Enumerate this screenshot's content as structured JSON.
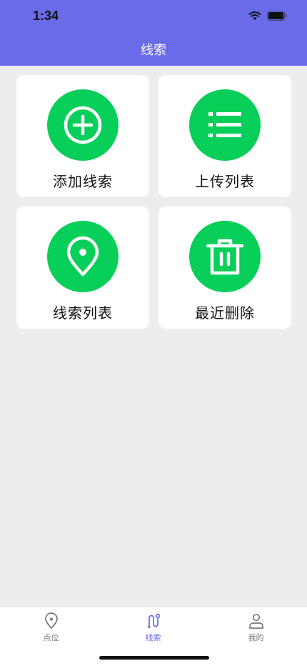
{
  "status_bar": {
    "time": "1:34"
  },
  "nav": {
    "title": "线索"
  },
  "cards": [
    {
      "label": "添加线索",
      "icon": "plus-circle-icon"
    },
    {
      "label": "上传列表",
      "icon": "list-icon"
    },
    {
      "label": "线索列表",
      "icon": "location-pin-icon"
    },
    {
      "label": "最近删除",
      "icon": "trash-icon"
    }
  ],
  "tabbar": {
    "items": [
      {
        "label": "点位",
        "icon": "location-pin-icon",
        "active": false
      },
      {
        "label": "线索",
        "icon": "route-icon",
        "active": true
      },
      {
        "label": "我的",
        "icon": "user-icon",
        "active": false
      }
    ]
  },
  "colors": {
    "header": "#6a6be9",
    "accent_green": "#07cf59",
    "background": "#ededed",
    "active_tab": "#6a6be9"
  }
}
